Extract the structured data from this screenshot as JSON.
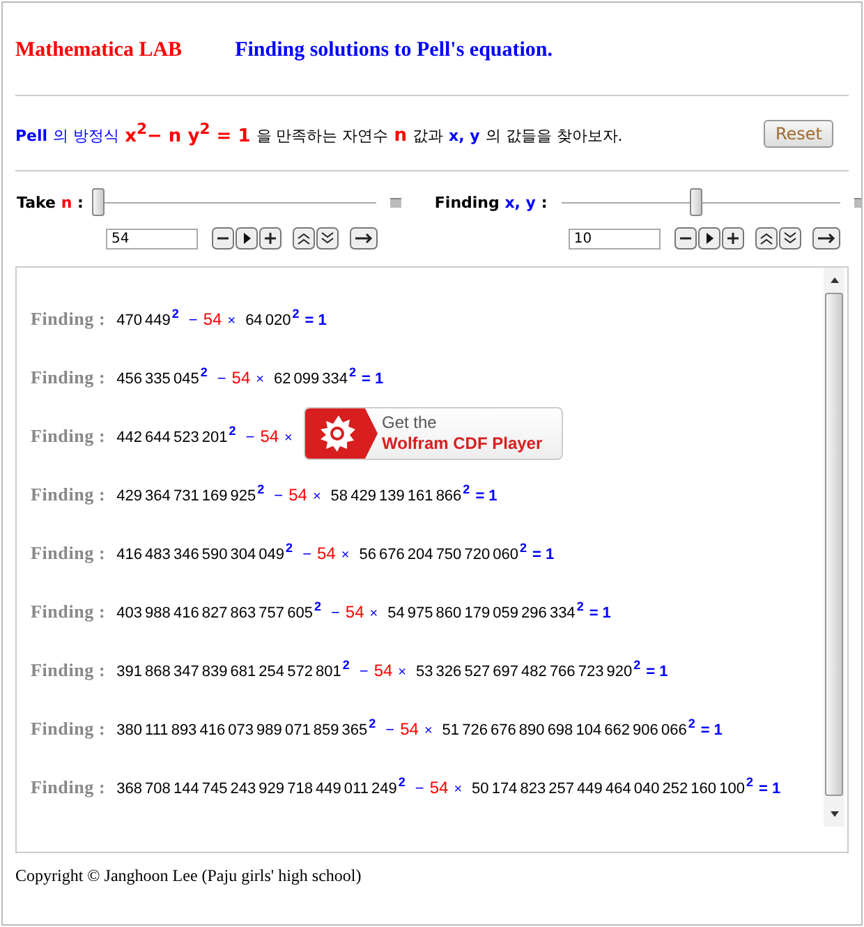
{
  "header": {
    "brand": "Mathematica LAB",
    "title": "Finding solutions to Pell's equation."
  },
  "intro": {
    "segments": [
      {
        "kind": "term",
        "text": "Pell"
      },
      {
        "kind": "term-light",
        "text": "의 방정식"
      },
      {
        "kind": "formula",
        "text": "x$^{2}$− n y$^{2}$ = 1"
      },
      {
        "kind": "plain",
        "text": "을 만족하는 자연수"
      },
      {
        "kind": "formula",
        "text": "n"
      },
      {
        "kind": "plain",
        "text": "값과"
      },
      {
        "kind": "term",
        "text": "x, y"
      },
      {
        "kind": "plain",
        "text": "의 값들을 찾아보자."
      }
    ],
    "reset_button": "Reset"
  },
  "controls": [
    {
      "label": "Take",
      "variable": "n",
      "suffix": ":",
      "level": 0.0,
      "value": "54"
    },
    {
      "label": "Finding",
      "variable": "x, y",
      "suffix": ":",
      "level": 0.48,
      "value": "10"
    }
  ],
  "results": {
    "rows": [
      {
        "label": "Finding :",
        "x": "470 449",
        "x_exp": "2",
        "minus": "−",
        "n": "54",
        "times": "×",
        "y": "64 020",
        "y_exp": "2",
        "equals": "= 1"
      },
      {
        "label": "Finding :",
        "x": "456 335 045",
        "x_exp": "2",
        "minus": "−",
        "n": "54",
        "times": "×",
        "y": "62 099 334",
        "y_exp": "2",
        "equals": "= 1"
      },
      {
        "label": "Finding :",
        "x": "442 644 523 201",
        "x_exp": "2",
        "minus": "−",
        "n": "54",
        "times": "×"
      },
      {
        "label": "Finding :",
        "x": "429 364 731 169 925",
        "x_exp": "2",
        "minus": "−",
        "n": "54",
        "times": "×",
        "y": "58 429 139 161 866",
        "y_exp": "2",
        "equals": "= 1"
      },
      {
        "label": "Finding :",
        "x": "416 483 346 590 304 049",
        "x_exp": "2",
        "minus": "−",
        "n": "54",
        "times": "×",
        "y": "56 676 204 750 720 060",
        "y_exp": "2",
        "equals": "= 1"
      },
      {
        "label": "Finding :",
        "x": "403 988 416 827 863 757 605",
        "x_exp": "2",
        "minus": "−",
        "n": "54",
        "times": "×",
        "y": "54 975 860 179 059 296 334",
        "y_exp": "2",
        "equals": "= 1"
      },
      {
        "label": "Finding :",
        "x": "391 868 347 839 681 254 572 801",
        "x_exp": "2",
        "minus": "−",
        "n": "54",
        "times": "×",
        "y": "53 326 527 697 482 766 723 920",
        "y_exp": "2",
        "equals": "= 1"
      },
      {
        "label": "Finding :",
        "x": "380 111 893 416 073 989 071 859 365",
        "x_exp": "2",
        "minus": "−",
        "n": "54",
        "times": "×",
        "y": "51 726 676 890 698 104 662 906 066",
        "y_exp": "2",
        "equals": "= 1"
      },
      {
        "label": "Finding :",
        "x": "368 708 144 745 243 929 718 449 011 249",
        "x_exp": "2",
        "minus": "−",
        "n": "54",
        "times": "×",
        "y": "50 174 823 257 449 464 040 252 160 100",
        "y_exp": "2",
        "equals": "= 1"
      }
    ],
    "player_badge": {
      "line_1": "Get the",
      "line_2": "Wolfram CDF Player"
    }
  },
  "footer": "Copyright © Janghoon Lee (Paju girls' high school)"
}
